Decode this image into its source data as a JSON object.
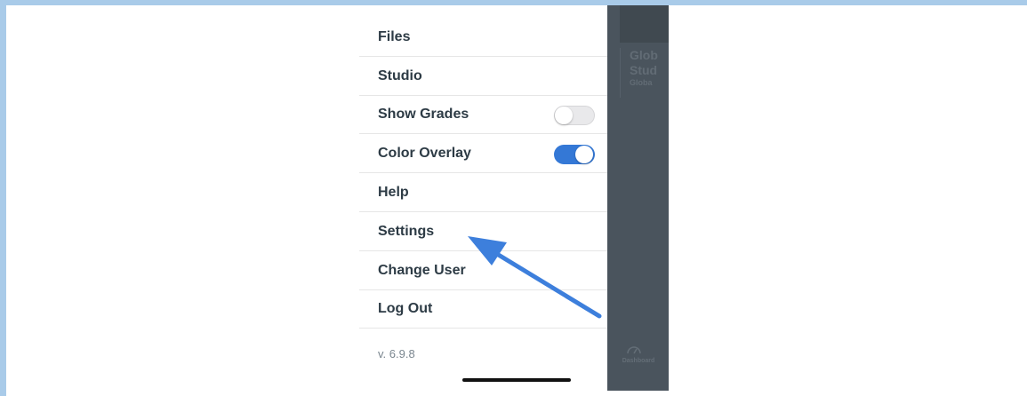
{
  "menu": {
    "items": [
      {
        "label": "Files"
      },
      {
        "label": "Studio"
      },
      {
        "label": "Show Grades",
        "toggle": "off"
      },
      {
        "label": "Color Overlay",
        "toggle": "on"
      },
      {
        "label": "Help"
      },
      {
        "label": "Settings"
      },
      {
        "label": "Change User"
      },
      {
        "label": "Log Out"
      }
    ],
    "version": "v. 6.9.8"
  },
  "background_screen": {
    "card_title_line1": "Glob",
    "card_title_line2": "Stud",
    "card_subtitle": "Globa",
    "tab_label": "Dashboard"
  },
  "colors": {
    "accent": "#3478d6",
    "arrow": "#3d7fdc",
    "text": "#2d3b45",
    "overlay": "#4a545d",
    "frame": "#a9cbe9"
  },
  "toggles": {
    "show_grades": false,
    "color_overlay": true
  }
}
